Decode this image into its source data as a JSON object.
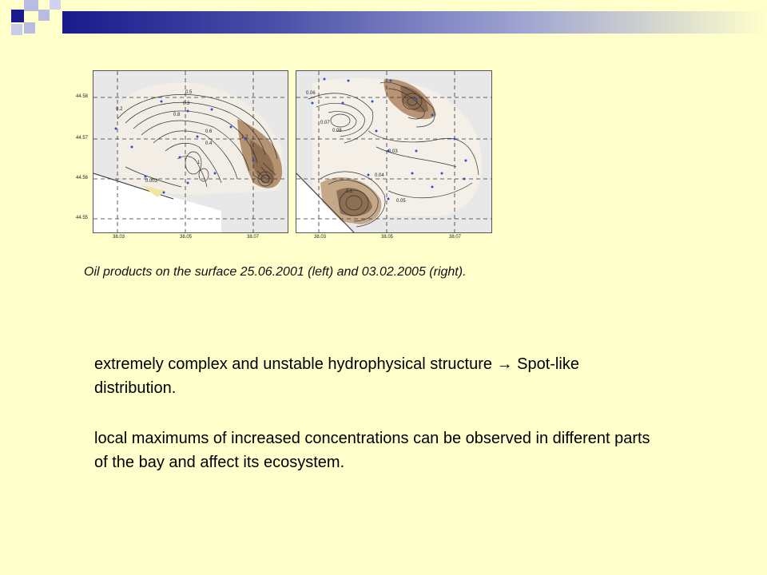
{
  "caption": "Oil products on the surface 25.06.2001 (left) and 03.02.2005 (right).",
  "bullets": [
    "extremely complex and unstable hydrophysical structure → Spot-like distribution.",
    "local maximums of increased concentrations can be observed in different parts of the bay and affect its ecosystem."
  ],
  "maps": {
    "left": {
      "y_ticks": [
        "44.58",
        "44.57",
        "44.56",
        "44.55"
      ],
      "x_ticks": [
        "38.03",
        "38.05",
        "38.07"
      ],
      "contour_labels": [
        "0.5",
        "0.8",
        "0.3",
        "0.6",
        "0.4",
        "0.2",
        "1",
        "1.2",
        "0.003"
      ]
    },
    "right": {
      "x_ticks": [
        "38.03",
        "38.05",
        "38.07"
      ],
      "contour_labels": [
        "0.06",
        "0.07",
        "0.08",
        "0.03",
        "0.04",
        "0.05",
        "0.1"
      ]
    }
  },
  "colors": {
    "background": "#ffffcc",
    "header_dark": "#1a1a8c",
    "header_light": "#b0b4d8"
  }
}
